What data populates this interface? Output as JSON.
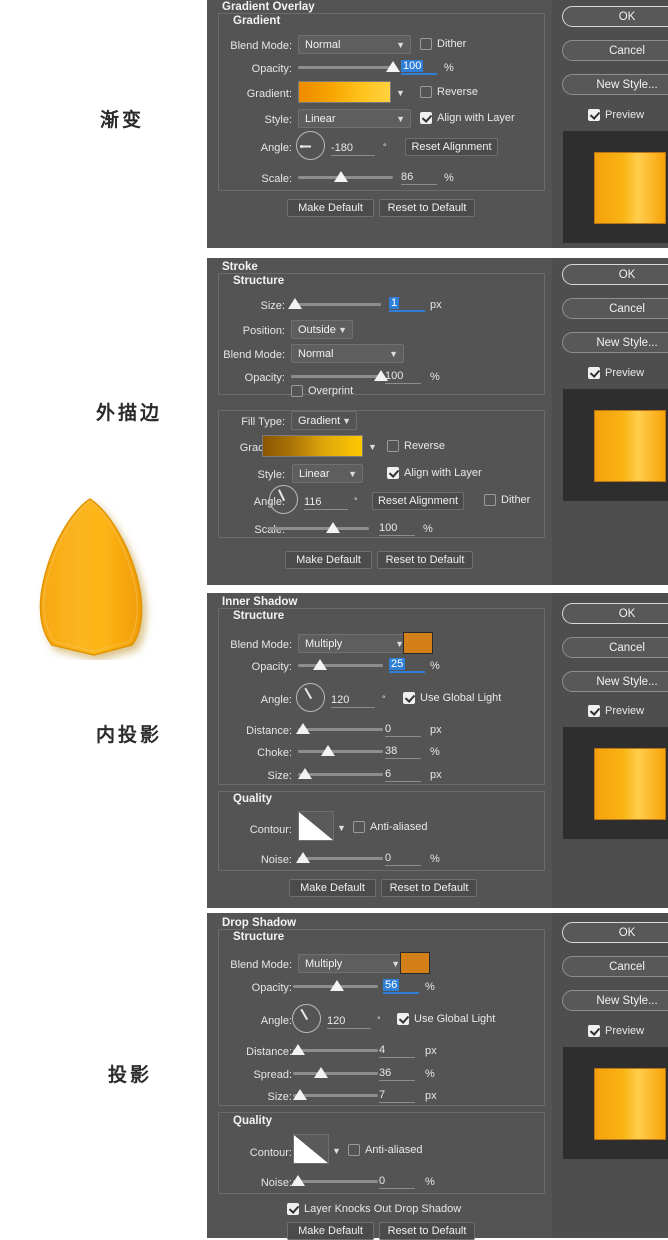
{
  "annotations": [
    {
      "text": "渐变",
      "name": "annotation-gradient"
    },
    {
      "text": "外描边",
      "name": "annotation-stroke"
    },
    {
      "text": "内投影",
      "name": "annotation-inner-shadow"
    },
    {
      "text": "投影",
      "name": "annotation-drop-shadow"
    }
  ],
  "common": {
    "ok": "OK",
    "cancel": "Cancel",
    "new_style": "New Style...",
    "preview": "Preview",
    "make_default": "Make Default",
    "reset_to_default": "Reset to Default",
    "structure": "Structure",
    "quality": "Quality",
    "blend_mode": "Blend Mode:",
    "opacity": "Opacity:",
    "angle": "Angle:",
    "distance": "Distance:",
    "size": "Size:",
    "noise": "Noise:",
    "contour": "Contour:",
    "anti_aliased": "Anti-aliased",
    "use_global_light": "Use Global Light",
    "gradient_label": "Gradient:",
    "style_label": "Style:",
    "scale_label": "Scale:",
    "reverse": "Reverse",
    "align_with_layer": "Align with Layer",
    "dither": "Dither",
    "reset_alignment": "Reset Alignment",
    "pct": "%",
    "px": "px",
    "deg": "°"
  },
  "colors": {
    "panel_bg": "#545454",
    "panel_right_bg": "#4e4e4e",
    "accent_select": "#2f7fd6",
    "shadow_color": "#d4801a",
    "grad_overlay_from": "#f29100",
    "grad_overlay_to": "#ffc41f",
    "grad_stroke_from": "#8a5a05",
    "grad_stroke_to": "#ffc800"
  },
  "sections": [
    {
      "id": "gradient-overlay",
      "title": "Gradient Overlay",
      "group_title": "Gradient",
      "fields": {
        "blend_mode": "Normal",
        "opacity": "100",
        "style": "Linear",
        "angle": "-180",
        "scale": "86"
      },
      "checks": {
        "dither": false,
        "reverse": false,
        "align_with_layer": true
      }
    },
    {
      "id": "stroke",
      "title": "Stroke",
      "group_title": "Structure",
      "fields": {
        "size": "1",
        "position": "Outside",
        "blend_mode": "Normal",
        "opacity": "100",
        "fill_type": "Gradient",
        "style": "Linear",
        "angle": "116",
        "scale": "100"
      },
      "labels": {
        "position": "Position:",
        "fill_type": "Fill Type:",
        "overprint": "Overprint"
      },
      "checks": {
        "overprint": false,
        "reverse": false,
        "align_with_layer": true,
        "dither": false
      }
    },
    {
      "id": "inner-shadow",
      "title": "Inner Shadow",
      "group_title": "Structure",
      "fields": {
        "blend_mode": "Multiply",
        "opacity": "25",
        "angle": "120",
        "distance": "0",
        "choke": "38",
        "size": "6",
        "noise": "0"
      },
      "labels": {
        "choke": "Choke:"
      },
      "checks": {
        "use_global_light": true,
        "anti_aliased": false
      }
    },
    {
      "id": "drop-shadow",
      "title": "Drop Shadow",
      "group_title": "Structure",
      "fields": {
        "blend_mode": "Multiply",
        "opacity": "56",
        "angle": "120",
        "distance": "4",
        "spread": "36",
        "size": "7",
        "noise": "0"
      },
      "labels": {
        "spread": "Spread:",
        "layer_knocks_out": "Layer Knocks Out Drop Shadow"
      },
      "checks": {
        "use_global_light": true,
        "anti_aliased": false,
        "layer_knocks_out": true
      }
    }
  ]
}
